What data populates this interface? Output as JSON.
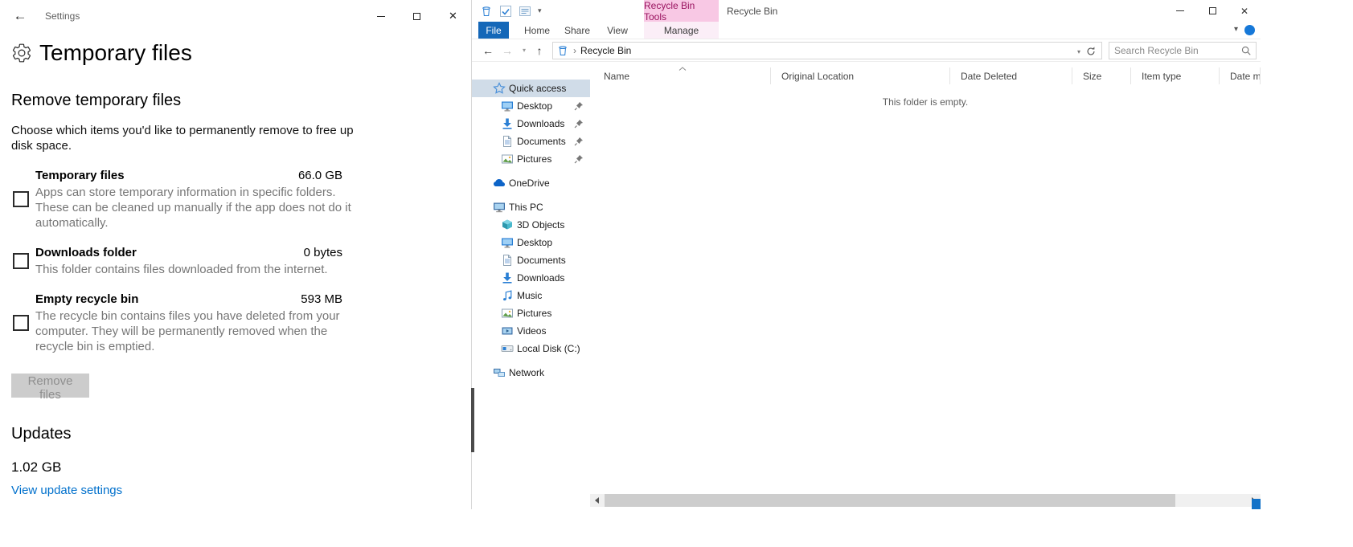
{
  "icons_glyphs": {
    "back_arrow": "←",
    "forward_arrow": "→",
    "up_arrow": "↑",
    "dropdown_caret": "▾",
    "close_glyph": "✕",
    "chevron_right": "›"
  },
  "settings_window": {
    "titlebar": {
      "title": "Settings"
    },
    "page_title": "Temporary files",
    "section": {
      "title": "Remove temporary files",
      "description": "Choose which items you'd like to permanently remove to free up disk space."
    },
    "cleanup_items": [
      {
        "label": "Temporary files",
        "size": "66.0 GB",
        "description": "Apps can store temporary information in specific folders. These can be cleaned up manually if the app does not do it automatically.",
        "checked": false
      },
      {
        "label": "Downloads folder",
        "size": "0 bytes",
        "description": "This folder contains files downloaded from the internet.",
        "checked": false
      },
      {
        "label": "Empty recycle bin",
        "size": "593 MB",
        "description": "The recycle bin contains files you have deleted from your computer. They will be permanently removed when the recycle bin is emptied.",
        "checked": false
      }
    ],
    "remove_button_label": "Remove files",
    "remove_button_enabled": false,
    "updates": {
      "title": "Updates",
      "size": "1.02 GB",
      "link": "View update settings"
    }
  },
  "explorer_window": {
    "titlebar": {
      "contextual_tab": "Recycle Bin Tools",
      "title": "Recycle Bin"
    },
    "ribbon_tabs": {
      "file": "File",
      "home": "Home",
      "share": "Share",
      "view": "View",
      "manage": "Manage"
    },
    "toolbar": {
      "location": "Recycle Bin",
      "search_placeholder": "Search Recycle Bin"
    },
    "columns": [
      "Name",
      "Original Location",
      "Date Deleted",
      "Size",
      "Item type",
      "Date modified"
    ],
    "navigation": {
      "items": [
        {
          "label": "Quick access",
          "icon": "star",
          "level": 0,
          "selected": true,
          "pinned": false
        },
        {
          "label": "Desktop",
          "icon": "desktop",
          "level": 1,
          "pinned": true
        },
        {
          "label": "Downloads",
          "icon": "download",
          "level": 1,
          "pinned": true
        },
        {
          "label": "Documents",
          "icon": "document",
          "level": 1,
          "pinned": true
        },
        {
          "label": "Pictures",
          "icon": "picture",
          "level": 1,
          "pinned": true
        },
        {
          "label": "OneDrive",
          "icon": "onedrive",
          "level": 0,
          "gap_before": true
        },
        {
          "label": "This PC",
          "icon": "pc",
          "level": 0,
          "gap_before": true
        },
        {
          "label": "3D Objects",
          "icon": "cube",
          "level": 1
        },
        {
          "label": "Desktop",
          "icon": "desktop",
          "level": 1
        },
        {
          "label": "Documents",
          "icon": "document",
          "level": 1
        },
        {
          "label": "Downloads",
          "icon": "download",
          "level": 1
        },
        {
          "label": "Music",
          "icon": "music",
          "level": 1
        },
        {
          "label": "Pictures",
          "icon": "picture",
          "level": 1
        },
        {
          "label": "Videos",
          "icon": "video",
          "level": 1
        },
        {
          "label": "Local Disk (C:)",
          "icon": "disk",
          "level": 1
        },
        {
          "label": "Network",
          "icon": "network",
          "level": 0,
          "gap_before": true
        }
      ]
    },
    "empty_message": "This folder is empty."
  },
  "colors": {
    "file_tab_blue": "#1467b8",
    "contextual_tab_bg": "#f8c8e4",
    "contextual_tab_text": "#99135f",
    "link_blue": "#0070cc",
    "selected_nav_bg": "#d0dce8",
    "disabled_button_bg": "#cccccc"
  }
}
